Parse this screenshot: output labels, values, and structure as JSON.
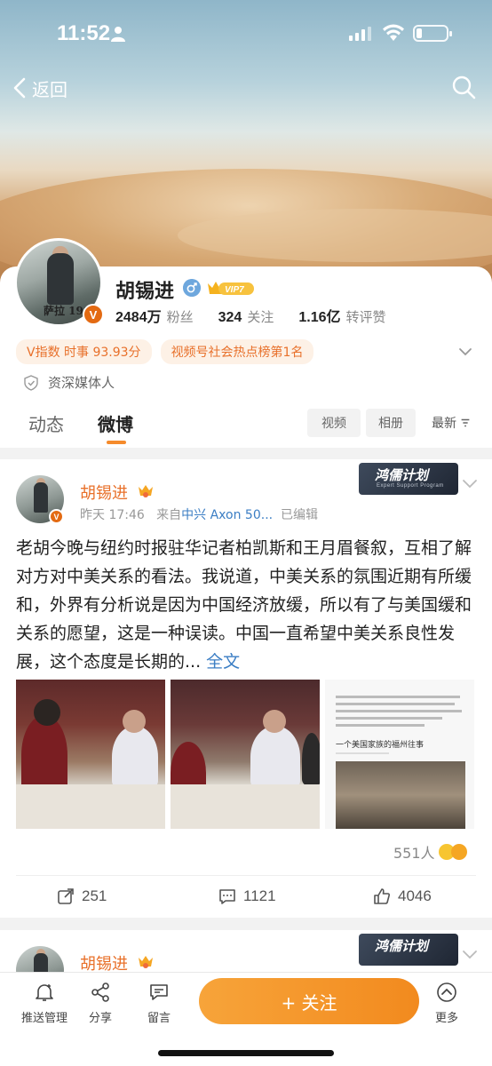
{
  "status": {
    "time": "11:52"
  },
  "nav": {
    "back_label": "返回"
  },
  "profile": {
    "name": "胡锡进",
    "vip_label": "VIP7",
    "avatar_signature": "萨拉 190",
    "verified_badge": "V",
    "followers_num": "2484万",
    "followers_label": "粉丝",
    "following_num": "324",
    "following_label": "关注",
    "likes_num": "1.16亿",
    "likes_label": "转评赞",
    "tag1": "V指数 时事 93.93分",
    "tag2": "视频号社会热点榜第1名",
    "certification": "资深媒体人"
  },
  "tabs": {
    "dongtai": "动态",
    "weibo": "微博",
    "video": "视频",
    "album": "相册",
    "newest": "最新"
  },
  "post": {
    "author": "胡锡进",
    "time": "昨天 17:46",
    "from_label": "来自",
    "source": "中兴 Axon 50...",
    "edited": "已编辑",
    "plan_badge": "鸿儒计划",
    "plan_badge_sub": "Expert Support Program",
    "text": "老胡今晚与纽约时报驻华记者柏凯斯和王月眉餐叙，互相了解对方对中美关系的看法。我说道，中美关系的氛围近期有所缓和，外界有分析说是因为中国经济放缓，所以有了与美国缓和关系的愿望，这是一种误读。中国一直希望中美关系良性发展，这个态度是长期的...",
    "full_text_link": "全文",
    "doc_title": "一个美国家族的福州往事",
    "views": "551人",
    "reposts": "251",
    "comments": "1121",
    "likes": "4046"
  },
  "post2": {
    "author": "胡锡进",
    "plan_badge": "鸿儒计划"
  },
  "bottombar": {
    "push": "推送管理",
    "share": "分享",
    "message": "留言",
    "follow": "+ 关注",
    "more": "更多"
  },
  "colors": {
    "accent": "#f28a1e",
    "link": "#3b7ec4",
    "name": "#e8702a"
  },
  "icons": [
    "person-icon",
    "signal-icon",
    "wifi-icon",
    "battery-icon",
    "back-chevron-icon",
    "search-icon",
    "male-icon",
    "vip-crown-icon",
    "more-chevron-icon",
    "shield-icon",
    "chevron-down-icon",
    "repost-icon",
    "comment-icon",
    "like-icon",
    "bell-icon",
    "share-icon",
    "message-icon",
    "more-icon"
  ]
}
